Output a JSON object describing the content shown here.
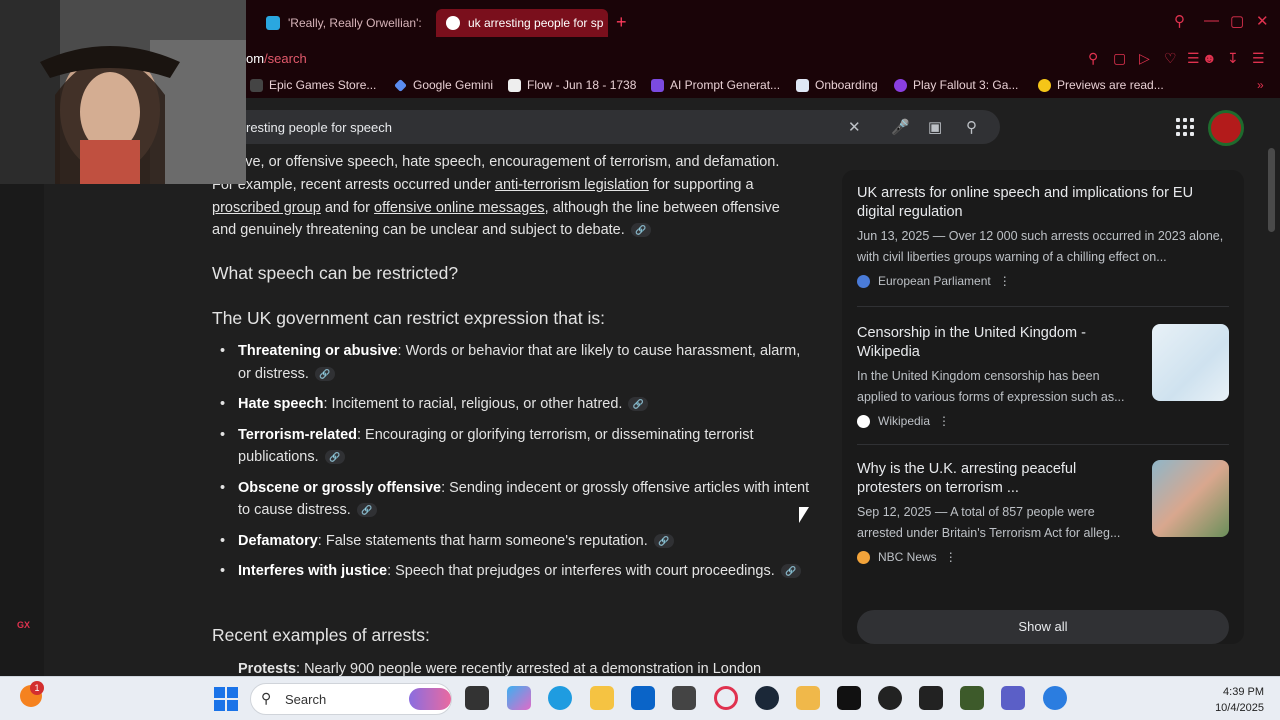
{
  "browser": {
    "tabs": [
      {
        "title": "'Really, Really Orwellian':",
        "active": false
      },
      {
        "title": "uk arresting people for sp",
        "active": true
      }
    ],
    "url_prefix": "om",
    "url_path": "/search",
    "bookmarks": [
      "Epic Games Store...",
      "Google Gemini",
      "Flow - Jun 18 - 1738",
      "AI Prompt Generat...",
      "Onboarding",
      "Play Fallout 3: Ga...",
      "Previews are read..."
    ]
  },
  "search": {
    "query": "resting people for speech"
  },
  "article": {
    "intro_line1": "ive, or offensive speech, hate speech, encouragement of terrorism, and defamation.",
    "intro_p_start": "For example, recent arrests occurred under ",
    "intro_link1": "anti-terrorism legislation",
    "intro_mid1": " for supporting a ",
    "intro_link2": "proscribed group",
    "intro_mid2": " and for ",
    "intro_link3": "offensive online messages",
    "intro_end": ", although the line between offensive and genuinely threatening can be unclear and subject to debate.",
    "heading1": "What speech can be restricted?",
    "heading2": "The UK government can restrict expression that is:",
    "restrictions": [
      {
        "term": "Threatening or abusive",
        "desc": ": Words or behavior that are likely to cause harassment, alarm, or distress."
      },
      {
        "term": "Hate speech",
        "desc": ": Incitement to racial, religious, or other hatred."
      },
      {
        "term": "Terrorism-related",
        "desc": ": Encouraging or glorifying terrorism, or disseminating terrorist publications."
      },
      {
        "term": "Obscene or grossly offensive",
        "desc": ": Sending indecent or grossly offensive articles with intent to cause distress."
      },
      {
        "term": "Defamatory",
        "desc": ": False statements that harm someone's reputation."
      },
      {
        "term": "Interferes with justice",
        "desc": ": Speech that prejudges or interferes with court proceedings."
      }
    ],
    "heading3": "Recent examples of arrests:",
    "last_item_term": "Protests",
    "last_item_desc": ": Nearly 900 people were recently arrested at a demonstration in London"
  },
  "sources": {
    "items": [
      {
        "title": "UK arrests for online speech and implications for EU digital regulation",
        "snippet": "Jun 13, 2025 — Over 12 000 such arrests occurred in 2023 alone, with civil liberties groups warning of a chilling effect on...",
        "source": "European Parliament",
        "icon_color": "#4a7bd8"
      },
      {
        "title": "Censorship in the United Kingdom - Wikipedia",
        "snippet": "In the United Kingdom censorship has been applied to various forms of expression such as...",
        "source": "Wikipedia",
        "icon_color": "#ffffff"
      },
      {
        "title": "Why is the U.K. arresting peaceful protesters on terrorism ...",
        "snippet": "Sep 12, 2025 — A total of 857 people were arrested under Britain's Terrorism Act for alleg...",
        "source": "NBC News",
        "icon_color": "#f2a33a"
      }
    ],
    "show_all": "Show all"
  },
  "taskbar": {
    "search_placeholder": "Search",
    "time": "4:39 PM",
    "date": "10/4/2025",
    "notification_count": "1"
  },
  "sidebar": {
    "gx_label": "GX"
  },
  "colors": {
    "accent": "#e0324f",
    "tab_active": "#7a0f1c",
    "page_bg": "#1f1f1f"
  }
}
